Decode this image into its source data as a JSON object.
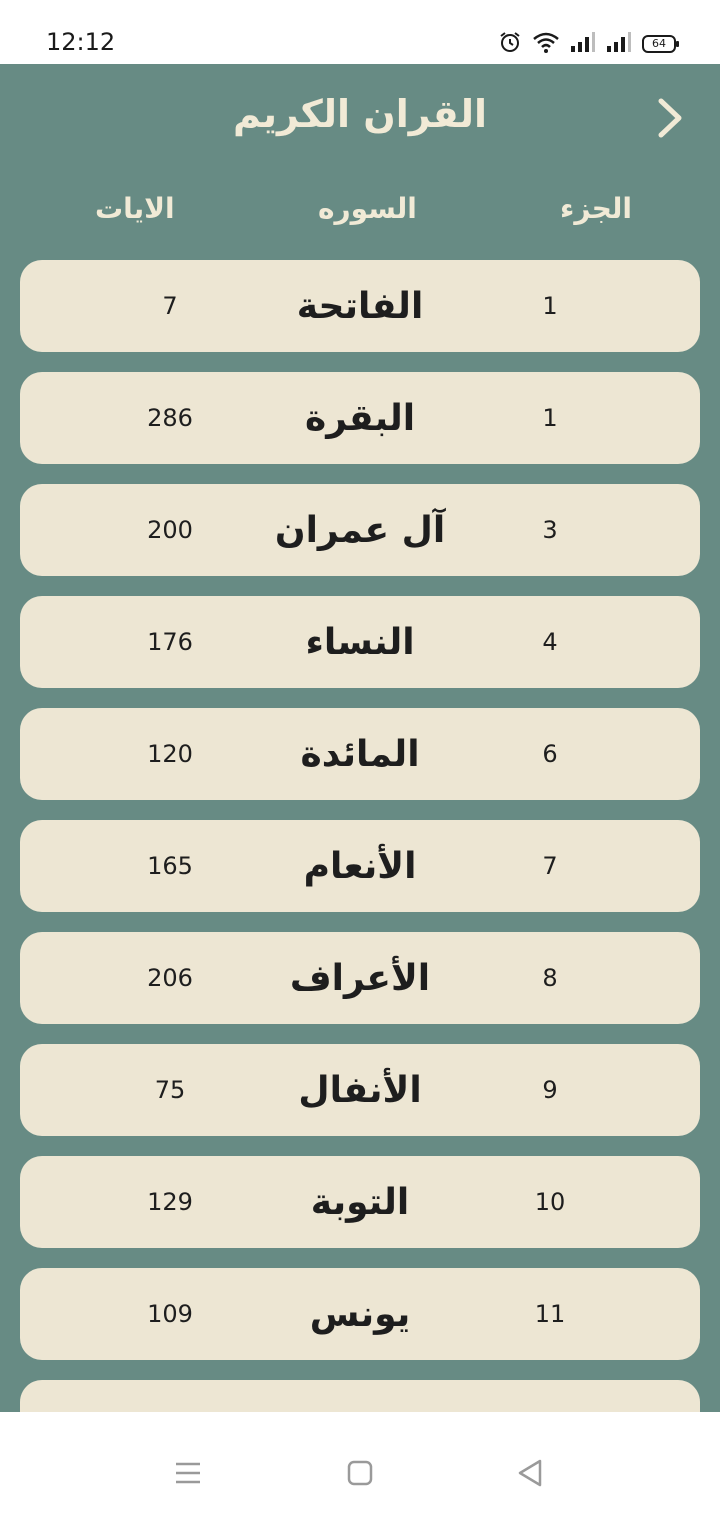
{
  "status": {
    "time": "12:12",
    "battery": "64"
  },
  "header": {
    "title": "القران الكريم"
  },
  "columns": {
    "juz": "الجزء",
    "surah": "السوره",
    "ayat": "الايات"
  },
  "surahs": [
    {
      "juz": "1",
      "name": "الفاتحة",
      "ayat": "7"
    },
    {
      "juz": "1",
      "name": "البقرة",
      "ayat": "286"
    },
    {
      "juz": "3",
      "name": "آل عمران",
      "ayat": "200"
    },
    {
      "juz": "4",
      "name": "النساء",
      "ayat": "176"
    },
    {
      "juz": "6",
      "name": "المائدة",
      "ayat": "120"
    },
    {
      "juz": "7",
      "name": "الأنعام",
      "ayat": "165"
    },
    {
      "juz": "8",
      "name": "الأعراف",
      "ayat": "206"
    },
    {
      "juz": "9",
      "name": "الأنفال",
      "ayat": "75"
    },
    {
      "juz": "10",
      "name": "التوبة",
      "ayat": "129"
    },
    {
      "juz": "11",
      "name": "يونس",
      "ayat": "109"
    }
  ],
  "icons": {
    "back": "chevron-right-icon",
    "alarm": "alarm-icon",
    "wifi": "wifi-icon",
    "signal": "signal-icon",
    "battery": "battery-icon",
    "menu": "menu-icon",
    "home": "home-icon",
    "nav_back": "back-triangle-icon"
  },
  "colors": {
    "background": "#678b84",
    "card": "#ede6d3",
    "header_text": "#f1ead6"
  }
}
